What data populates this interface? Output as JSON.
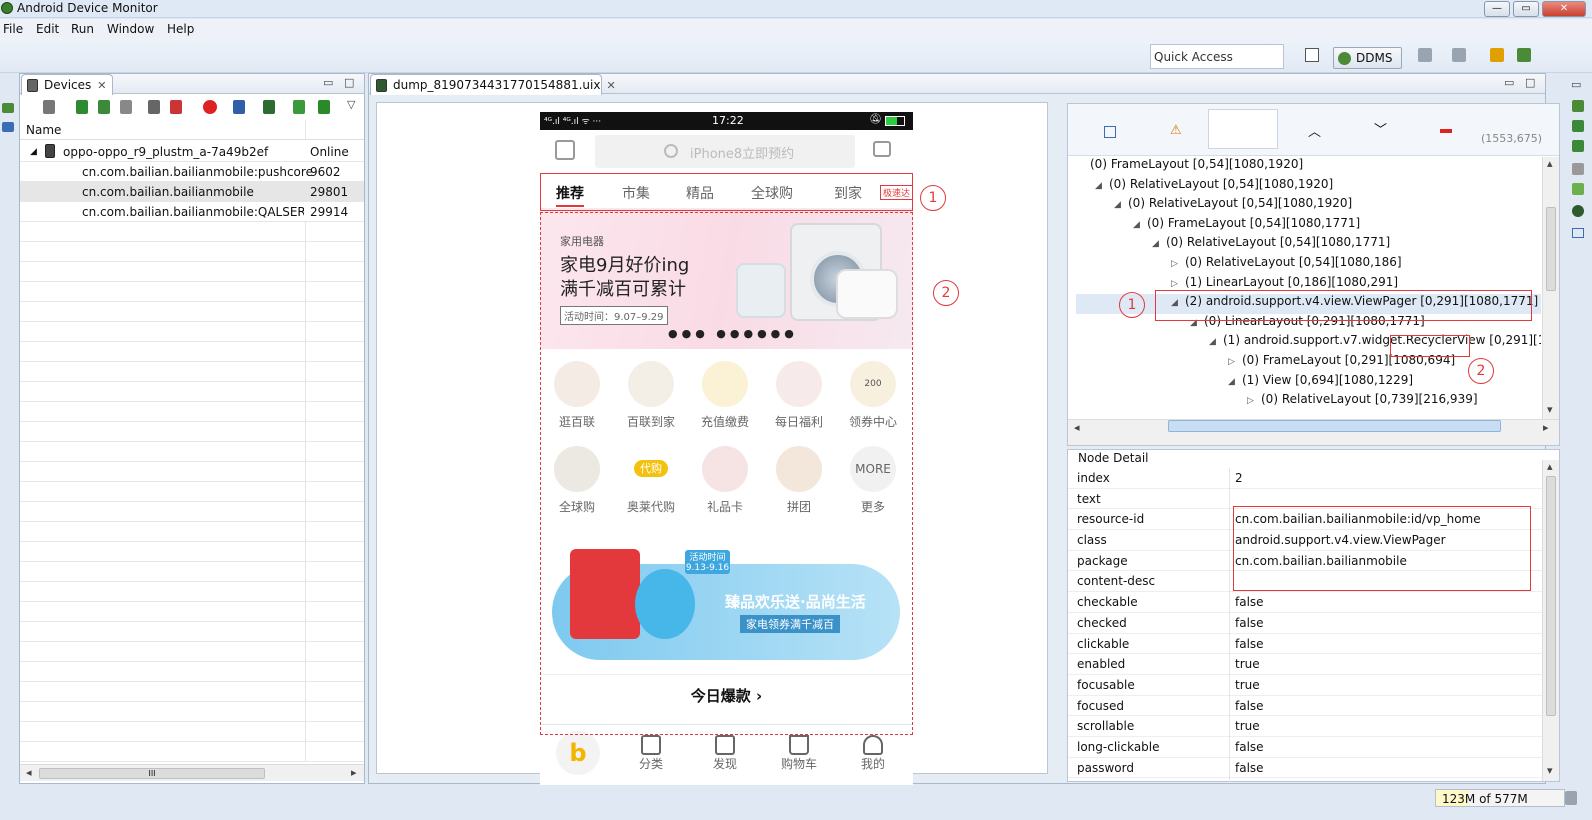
{
  "window": {
    "title": "Android Device Monitor",
    "min": "—",
    "max": "▭",
    "close": "✕"
  },
  "menu": [
    "File",
    "Edit",
    "Run",
    "Window",
    "Help"
  ],
  "toolbar": {
    "quick_access": "Quick Access",
    "ddms": "DDMS"
  },
  "devices_view": {
    "tab_label": "Devices",
    "close": "✕",
    "col_name": "Name",
    "rows": [
      {
        "name": "oppo-oppo_r9_plustm_a-7a49b2ef",
        "value": "Online"
      },
      {
        "name": "cn.com.bailian.bailianmobile:pushcore",
        "value": "9602"
      },
      {
        "name": "cn.com.bailian.bailianmobile",
        "value": "29801"
      },
      {
        "name": "cn.com.bailian.bailianmobile:QALSERVICE",
        "value": "29914"
      }
    ],
    "hscroll_label": "III"
  },
  "editor": {
    "tab_label": "dump_8190734431770154881.uix",
    "close": "✕"
  },
  "phone": {
    "time": "17:22",
    "signal": "⁴ᴳ.ıl ⁴ᴳ.ıl ᯤ ···",
    "search_placeholder": "iPhone8立即预约",
    "tabs": [
      "推荐",
      "市集",
      "精品",
      "全球购",
      "到家"
    ],
    "speed_badge": "极速达",
    "banner": {
      "small": "家用电器",
      "line1": "家电9月好价ing",
      "line2": "满千减百可累计",
      "period": "活动时间：9.07–9.29",
      "dots": "●●● ●●●●●●"
    },
    "grid": [
      {
        "label": "逛百联",
        "icon": "bag-icon"
      },
      {
        "label": "百联到家",
        "icon": "box-icon"
      },
      {
        "label": "充值缴费",
        "icon": "coin-icon"
      },
      {
        "label": "每日福利",
        "icon": "calendar-icon"
      },
      {
        "label": "领券中心",
        "icon": "coupon-icon"
      },
      {
        "label": "全球购",
        "icon": "globe-icon"
      },
      {
        "label": "奥莱代购",
        "icon": "daigou-icon"
      },
      {
        "label": "礼品卡",
        "icon": "giftcard-icon"
      },
      {
        "label": "拼团",
        "icon": "crab-icon"
      },
      {
        "label": "更多",
        "icon": "more-icon"
      }
    ],
    "daigou_badge": "代购",
    "more_text": "MORE",
    "coupon_text": "200",
    "promo": {
      "main": "臻品欢乐送·品尚生活",
      "sub": "家电领券满千减百",
      "badge": "活动时间 9.13-9.16"
    },
    "today": "今日爆款 ›",
    "bottom_nav": [
      "分类",
      "发现",
      "购物车",
      "我的"
    ],
    "home_glyph": "b"
  },
  "annotations": {
    "one": "1",
    "two": "2"
  },
  "hierarchy": {
    "coords": "(1553,675)",
    "rows": [
      {
        "indent": 0,
        "arrow": "",
        "text": "(0) FrameLayout [0,54][1080,1920]"
      },
      {
        "indent": 1,
        "arrow": "◢",
        "text": "(0) RelativeLayout [0,54][1080,1920]"
      },
      {
        "indent": 2,
        "arrow": "◢",
        "text": "(0) RelativeLayout [0,54][1080,1920]"
      },
      {
        "indent": 3,
        "arrow": "◢",
        "text": "(0) FrameLayout [0,54][1080,1771]"
      },
      {
        "indent": 4,
        "arrow": "◢",
        "text": "(0) RelativeLayout [0,54][1080,1771]"
      },
      {
        "indent": 5,
        "arrow": "▷",
        "text": "(0) RelativeLayout [0,54][1080,186]"
      },
      {
        "indent": 5,
        "arrow": "▷",
        "text": "(1) LinearLayout [0,186][1080,291]"
      },
      {
        "indent": 5,
        "arrow": "◢",
        "text": "(2) android.support.v4.view.ViewPager [0,291][1080,1771]"
      },
      {
        "indent": 6,
        "arrow": "◢",
        "text": "(0) LinearLayout [0,291][1080,1771]"
      },
      {
        "indent": 7,
        "arrow": "◢",
        "text": "(1) android.support.v7.widget.RecyclerView [0,291][1080,1"
      },
      {
        "indent": 8,
        "arrow": "▷",
        "text": "(0) FrameLayout [0,291][1080,694]"
      },
      {
        "indent": 8,
        "arrow": "◢",
        "text": "(1) View [0,694][1080,1229]"
      },
      {
        "indent": 9,
        "arrow": "▷",
        "text": "(0) RelativeLayout [0,739][216,939]"
      }
    ]
  },
  "node_detail": {
    "title": "Node Detail",
    "rows": [
      {
        "k": "index",
        "v": "2"
      },
      {
        "k": "text",
        "v": ""
      },
      {
        "k": "resource-id",
        "v": "cn.com.bailian.bailianmobile:id/vp_home"
      },
      {
        "k": "class",
        "v": "android.support.v4.view.ViewPager"
      },
      {
        "k": "package",
        "v": "cn.com.bailian.bailianmobile"
      },
      {
        "k": "content-desc",
        "v": ""
      },
      {
        "k": "checkable",
        "v": "false"
      },
      {
        "k": "checked",
        "v": "false"
      },
      {
        "k": "clickable",
        "v": "false"
      },
      {
        "k": "enabled",
        "v": "true"
      },
      {
        "k": "focusable",
        "v": "true"
      },
      {
        "k": "focused",
        "v": "false"
      },
      {
        "k": "scrollable",
        "v": "true"
      },
      {
        "k": "long-clickable",
        "v": "false"
      },
      {
        "k": "password",
        "v": "false"
      }
    ]
  },
  "status": {
    "memory": "123M of 577M"
  }
}
